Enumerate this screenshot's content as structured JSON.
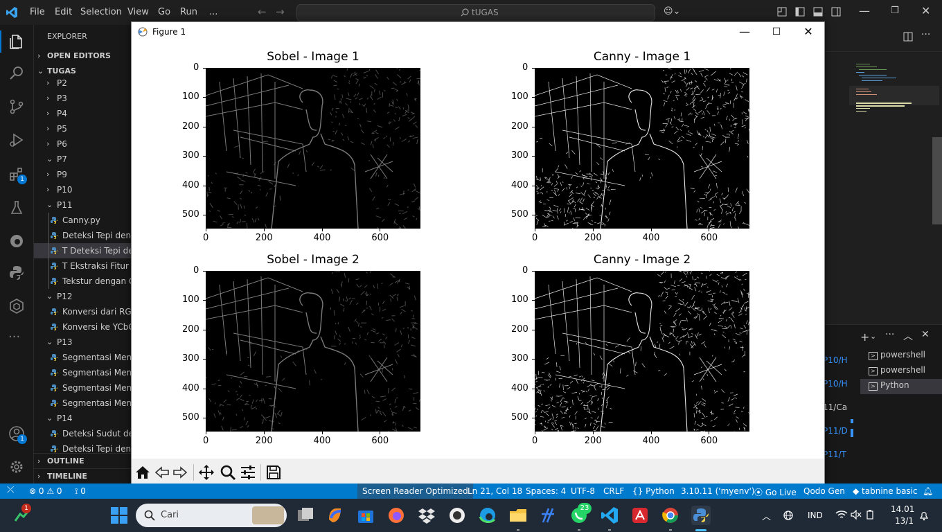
{
  "menu": [
    "File",
    "Edit",
    "Selection",
    "View",
    "Go",
    "Run",
    "..."
  ],
  "search": {
    "text": "tUGAS"
  },
  "sidebar": {
    "header": "EXPLORER",
    "open_editors": "OPEN EDITORS",
    "root": "TUGAS",
    "rows": [
      {
        "label": "P2",
        "kind": "folder",
        "open": false
      },
      {
        "label": "P3",
        "kind": "folder",
        "open": false
      },
      {
        "label": "P4",
        "kind": "folder",
        "open": false
      },
      {
        "label": "P5",
        "kind": "folder",
        "open": false
      },
      {
        "label": "P6",
        "kind": "folder",
        "open": false
      },
      {
        "label": "P7",
        "kind": "folder",
        "open": true
      },
      {
        "label": "P9",
        "kind": "folder",
        "open": false
      },
      {
        "label": "P10",
        "kind": "folder",
        "open": false
      },
      {
        "label": "P11",
        "kind": "folder",
        "open": true
      },
      {
        "label": "Canny.py",
        "kind": "file"
      },
      {
        "label": "Deteksi Tepi deng",
        "kind": "file"
      },
      {
        "label": "T Deteksi Tepi den",
        "kind": "file",
        "selected": true
      },
      {
        "label": "T Ekstraksi Fitur T",
        "kind": "file"
      },
      {
        "label": "Tekstur dengan G",
        "kind": "file"
      },
      {
        "label": "P12",
        "kind": "folder",
        "open": true
      },
      {
        "label": "Konversi dari RGE",
        "kind": "file"
      },
      {
        "label": "Konversi ke YCbC",
        "kind": "file"
      },
      {
        "label": "P13",
        "kind": "folder",
        "open": true
      },
      {
        "label": "Segmentasi Meng",
        "kind": "file"
      },
      {
        "label": "Segmentasi Meng",
        "kind": "file"
      },
      {
        "label": "Segmentasi Meng",
        "kind": "file"
      },
      {
        "label": "Segmentasi Meng",
        "kind": "file"
      },
      {
        "label": "P14",
        "kind": "folder",
        "open": true
      },
      {
        "label": "Deteksi Sudut de",
        "kind": "file"
      },
      {
        "label": "Deteksi Tepi deng",
        "kind": "file"
      }
    ],
    "outline": "OUTLINE",
    "timeline": "TIMELINE"
  },
  "activity_badges": {
    "extensions": "1",
    "accounts": "1"
  },
  "figure": {
    "title": "Figure 1",
    "plots": [
      {
        "title": "Sobel - Image 1",
        "kind": "sobel"
      },
      {
        "title": "Canny - Image 1",
        "kind": "canny"
      },
      {
        "title": "Sobel - Image 2",
        "kind": "sobel"
      },
      {
        "title": "Canny - Image 2",
        "kind": "canny"
      }
    ],
    "yticks": [
      "0",
      "100",
      "200",
      "300",
      "400",
      "500"
    ],
    "xticks": [
      "0",
      "200",
      "400",
      "600"
    ]
  },
  "terminal": {
    "tabs": [
      "powershell",
      "powershell",
      "Python"
    ],
    "left_paths": [
      "P10/H",
      "P10/H",
      "11/Ca",
      "P11/D",
      "P11/T"
    ]
  },
  "statusbar": {
    "errors": "0",
    "warnings": "0",
    "ports": "0",
    "screen_reader": "Screen Reader Optimized",
    "position": "Ln 21, Col 18",
    "spaces": "Spaces: 4",
    "encoding": "UTF-8",
    "eol": "CRLF",
    "language": "Python",
    "interpreter": "3.10.11 ('myenv')",
    "golive": "Go Live",
    "qodo": "Qodo Gen",
    "tabnine": "tabnine basic"
  },
  "taskbar": {
    "search_placeholder": "Cari",
    "whatsapp_badge": "23",
    "start_badge": "1",
    "lang": "IND",
    "time": "14.01",
    "date": "13/1"
  },
  "colors": {
    "accent": "#007acc",
    "selected_row": "#37373d",
    "badge": "#0078d4"
  }
}
